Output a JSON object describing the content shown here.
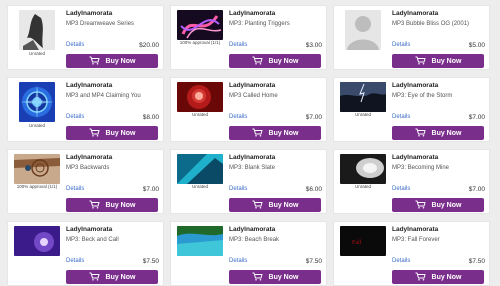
{
  "buy_label": "Buy Now",
  "details_label": "Details",
  "products": [
    {
      "seller": "LadyInamorata",
      "title": "MP3 Dreamweave Series",
      "price": "$20.00",
      "caption": "Unrated",
      "thumb": "dream"
    },
    {
      "seller": "LadyInamorata",
      "title": "MP3: Planting Triggers",
      "price": "$3.00",
      "caption": "100% approval (1/1)",
      "thumb": "triggers"
    },
    {
      "seller": "LadyInamorata",
      "title": "MP3 Bubble Bliss OG (2001)",
      "price": "$5.00",
      "caption": "",
      "thumb": "avatar"
    },
    {
      "seller": "LadyInamorata",
      "title": "MP3 and MP4 Claiming You",
      "price": "$8.00",
      "caption": "Unrated",
      "thumb": "mandala"
    },
    {
      "seller": "LadyInamorata",
      "title": "MP3 Called Home",
      "price": "$7.00",
      "caption": "Unrated",
      "thumb": "called"
    },
    {
      "seller": "LadyInamorata",
      "title": "MP3: Eye of the Storm",
      "price": "$7.00",
      "caption": "Unrated",
      "thumb": "storm"
    },
    {
      "seller": "LadyInamorata",
      "title": "MP3 Backwards",
      "price": "$7.00",
      "caption": "100% approval (1/1)",
      "thumb": "backwards"
    },
    {
      "seller": "LadyInamorata",
      "title": "MP3: Blank Slate",
      "price": "$6.00",
      "caption": "Unrated",
      "thumb": "slate"
    },
    {
      "seller": "LadyInamorata",
      "title": "MP3: Becoming Mine",
      "price": "$7.00",
      "caption": "Unrated",
      "thumb": "mine"
    },
    {
      "seller": "LadyInamorata",
      "title": "MP3: Beck and Call",
      "price": "$7.50",
      "caption": "",
      "thumb": "beck"
    },
    {
      "seller": "LadyInamorata",
      "title": "MP3: Beach Break",
      "price": "$7.50",
      "caption": "",
      "thumb": "beach"
    },
    {
      "seller": "LadyInamorata",
      "title": "MP3: Fall Forever",
      "price": "$7.50",
      "caption": "",
      "thumb": "fall"
    }
  ]
}
